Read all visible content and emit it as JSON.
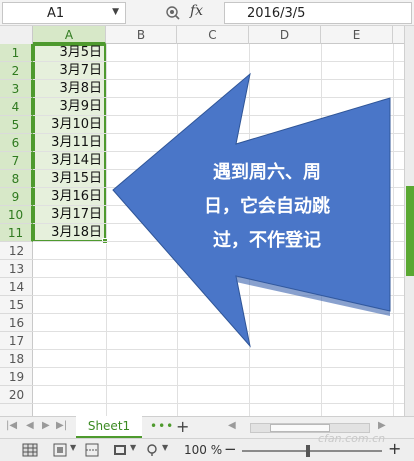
{
  "formula_bar": {
    "name_box": "A1",
    "fx_label": "fx",
    "formula_value": "2016/3/5"
  },
  "columns": [
    "A",
    "B",
    "C",
    "D",
    "E"
  ],
  "rows": [
    "1",
    "2",
    "3",
    "4",
    "5",
    "6",
    "7",
    "8",
    "9",
    "10",
    "11",
    "12",
    "13",
    "14",
    "15",
    "16",
    "17",
    "18",
    "19",
    "20"
  ],
  "cells_a": [
    "3月5日",
    "3月7日",
    "3月8日",
    "3月9日",
    "3月10日",
    "3月11日",
    "3月14日",
    "3月15日",
    "3月16日",
    "3月17日",
    "3月18日"
  ],
  "callout": {
    "line1": "遇到周六、周",
    "line2": "日，它会自动跳",
    "line3": "过，不作登记",
    "color": "#4a76c8"
  },
  "sheet_tabs": {
    "active": "Sheet1",
    "more": "•••",
    "add": "+"
  },
  "status": {
    "zoom": "100 %",
    "minus": "−",
    "plus": "+",
    "zoom_fraction": 0.46
  },
  "watermark": "cfan.com.cn",
  "colors": {
    "accent": "#4e9a2e",
    "selection_fill": "#e6f0dc"
  },
  "icons": [
    "zoom-icon",
    "normal-view-icon",
    "page-layout-icon",
    "reading-view-icon",
    "eye-protect-icon"
  ]
}
